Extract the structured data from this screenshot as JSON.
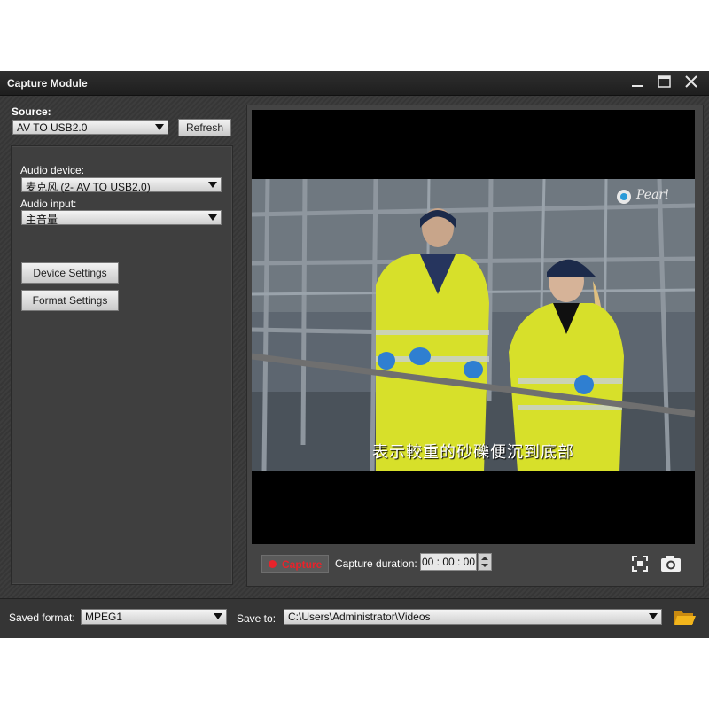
{
  "window": {
    "title": "Capture Module"
  },
  "source": {
    "label": "Source:",
    "value": "AV TO USB2.0",
    "refresh_label": "Refresh"
  },
  "audio": {
    "device_label": "Audio device:",
    "device_value": "麦克风 (2- AV TO USB2.0)",
    "input_label": "Audio input:",
    "input_value": "主音量"
  },
  "buttons": {
    "device_settings": "Device Settings",
    "format_settings": "Format Settings"
  },
  "video": {
    "subtitle": "表示較重的砂礫便沉到底部",
    "logo_text": "Pearl"
  },
  "capture": {
    "button_label": "Capture",
    "duration_label": "Capture duration:",
    "duration_value": "00 : 00 : 00"
  },
  "footer": {
    "saved_format_label": "Saved format:",
    "saved_format_value": "MPEG1",
    "save_to_label": "Save to:",
    "save_to_value": "C:\\Users\\Administrator\\Videos"
  },
  "icons": {
    "minimize": "minimize-icon",
    "maximize": "maximize-icon",
    "close": "close-icon",
    "fullscreen": "fullscreen-icon",
    "snapshot": "camera-icon",
    "folder": "folder-icon"
  },
  "colors": {
    "capture_red": "#e8232b",
    "folder_yellow": "#f2b51c"
  }
}
